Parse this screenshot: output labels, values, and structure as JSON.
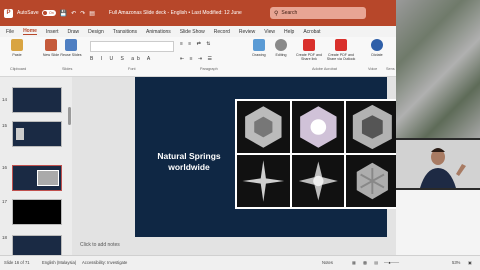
{
  "titlebar": {
    "logo_letter": "P",
    "autosave_label": "AutoSave",
    "autosave_state": "On",
    "document_title": "Full Amazonas Slide deck - English • Last Modified: 12 June",
    "search_placeholder": "Search"
  },
  "menu": {
    "tabs": [
      "File",
      "Home",
      "Insert",
      "Draw",
      "Design",
      "Transitions",
      "Animations",
      "Slide Show",
      "Record",
      "Review",
      "View",
      "Help",
      "Acrobat"
    ],
    "active_index": 1
  },
  "ribbon": {
    "paste": "Paste",
    "new_slide": "New Slide",
    "reuse_slides": "Reuse Slides",
    "drawing": "Drawing",
    "editing": "Editing",
    "create_pdf_share": "Create PDF and Share link",
    "create_pdf_outlook": "Create PDF and Share via Outlook",
    "dictate": "Dictate",
    "groups": {
      "clipboard": "Clipboard",
      "slides": "Slides",
      "font": "Font",
      "paragraph": "Paragraph",
      "adobe": "Adobe Acrobat",
      "voice": "Voice",
      "sensitivity": "Sens"
    }
  },
  "thumbnails": [
    {
      "num": "14"
    },
    {
      "num": "15"
    },
    {
      "num": "16"
    },
    {
      "num": "17"
    },
    {
      "num": "18"
    }
  ],
  "slide": {
    "title_line1": "Natural Springs",
    "title_line2": "worldwide"
  },
  "notes_placeholder": "Click to add notes",
  "status": {
    "slide_count": "Slide 16 of 71",
    "language": "English (Malaysia)",
    "accessibility": "Accessibility: Investigate",
    "notes": "Notes",
    "zoom": "53%"
  },
  "colors": {
    "accent": "#b7472a",
    "slide_bg": "#0f2744"
  }
}
